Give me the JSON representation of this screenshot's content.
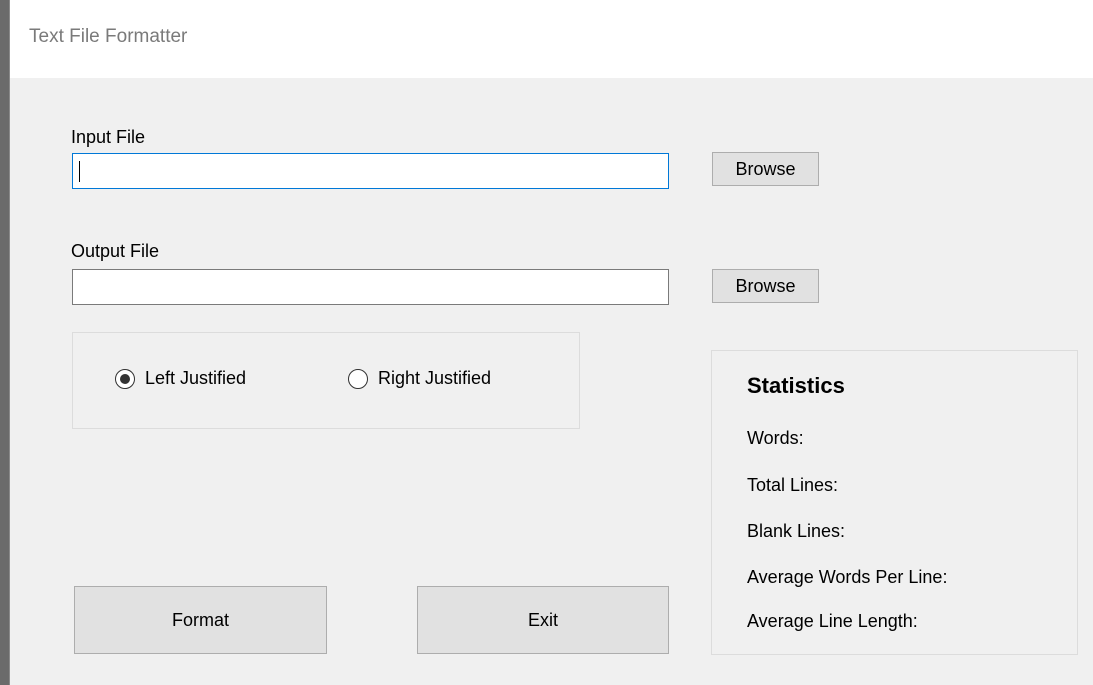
{
  "window": {
    "title": "Text File Formatter"
  },
  "input_file": {
    "label": "Input File",
    "value": "",
    "browse_label": "Browse"
  },
  "output_file": {
    "label": "Output File",
    "value": "",
    "browse_label": "Browse"
  },
  "justification": {
    "options": [
      {
        "label": "Left Justified",
        "selected": true
      },
      {
        "label": "Right Justified",
        "selected": false
      }
    ]
  },
  "statistics": {
    "title": "Statistics",
    "rows": [
      {
        "label": "Words:"
      },
      {
        "label": "Total Lines:"
      },
      {
        "label": "Blank Lines:"
      },
      {
        "label": "Average Words Per Line:"
      },
      {
        "label": "Average Line Length:"
      }
    ]
  },
  "actions": {
    "format_label": "Format",
    "exit_label": "Exit"
  }
}
